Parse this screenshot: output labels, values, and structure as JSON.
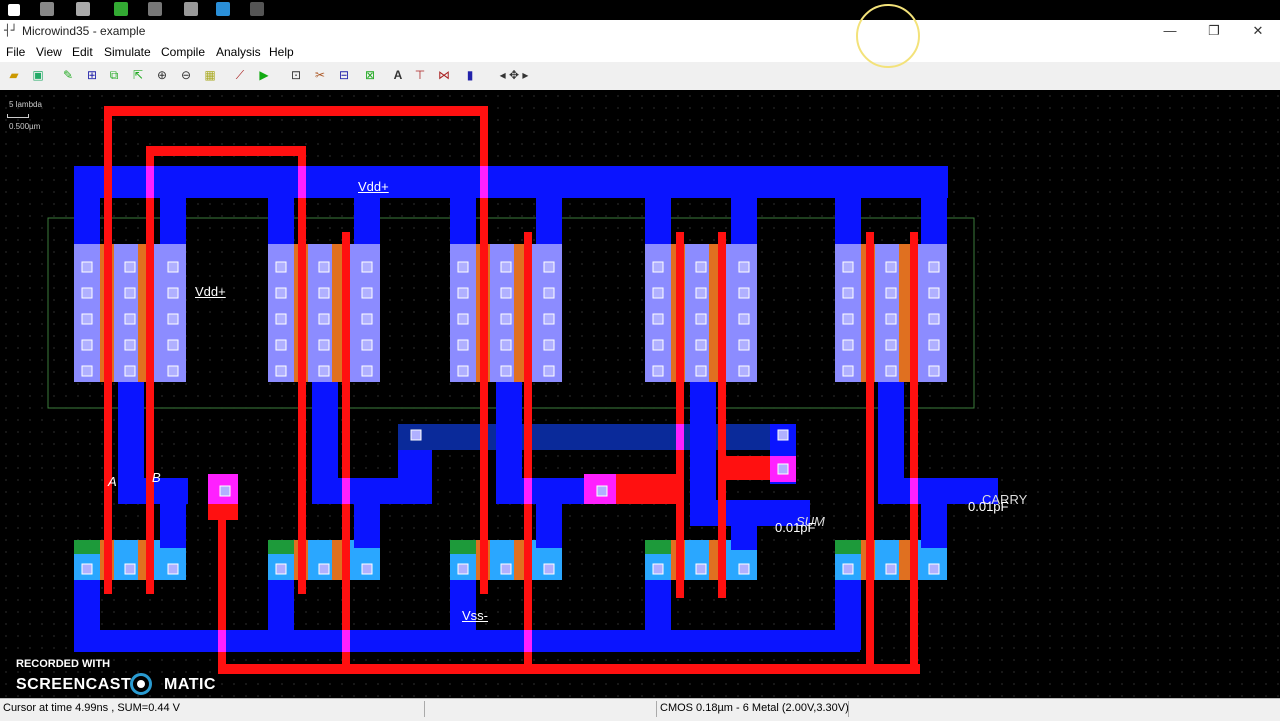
{
  "window": {
    "title": "Microwind35 - example",
    "app_icon": "microwind-icon",
    "controls": {
      "minimize": "—",
      "restore": "❐",
      "close": "✕"
    }
  },
  "menubar": {
    "items": [
      "File",
      "View",
      "Edit",
      "Simulate",
      "Compile",
      "Analysis",
      "Help"
    ]
  },
  "toolbar": {
    "tools": [
      "open-icon",
      "save-icon",
      "draw-icon",
      "connect-icon",
      "copy-icon",
      "move-icon",
      "zoom-in-icon",
      "zoom-out-icon",
      "fit-icon",
      "measure-icon",
      "run-icon",
      "protect-icon",
      "cut-icon",
      "duplicate-icon",
      "via-icon",
      "text-icon",
      "node-icon",
      "clock-icon",
      "simulate-icon",
      "arrows-icon"
    ]
  },
  "canvas": {
    "scale_lambda": "5 lambda",
    "scale_um": "0.500µm",
    "labels": {
      "vdd_top": "Vdd+",
      "vdd_well": "Vdd+",
      "vss": "Vss-",
      "input_a": "A",
      "input_b": "B",
      "cap_sum": "0.01pF",
      "cap_carry": "0.01pF",
      "out_sum": "SUM",
      "out_carry": "CARRY"
    }
  },
  "statusbar": {
    "cursor_info": "Cursor at  time 4.99ns , SUM=0.44 V",
    "technology": "CMOS 0.18µm - 6 Metal (2.00V,3.30V)"
  },
  "watermark": {
    "line1": "RECORDED WITH",
    "brand_left": "SCREENCAST",
    "brand_right": "MATIC"
  },
  "colors": {
    "metal1": "#0a14ff",
    "poly": "#ff1010",
    "diffusion_p": "#8c8cff",
    "contact": "#ff20ff",
    "nwell": "#3c7d3c",
    "ndiff": "#2aa7ff"
  }
}
